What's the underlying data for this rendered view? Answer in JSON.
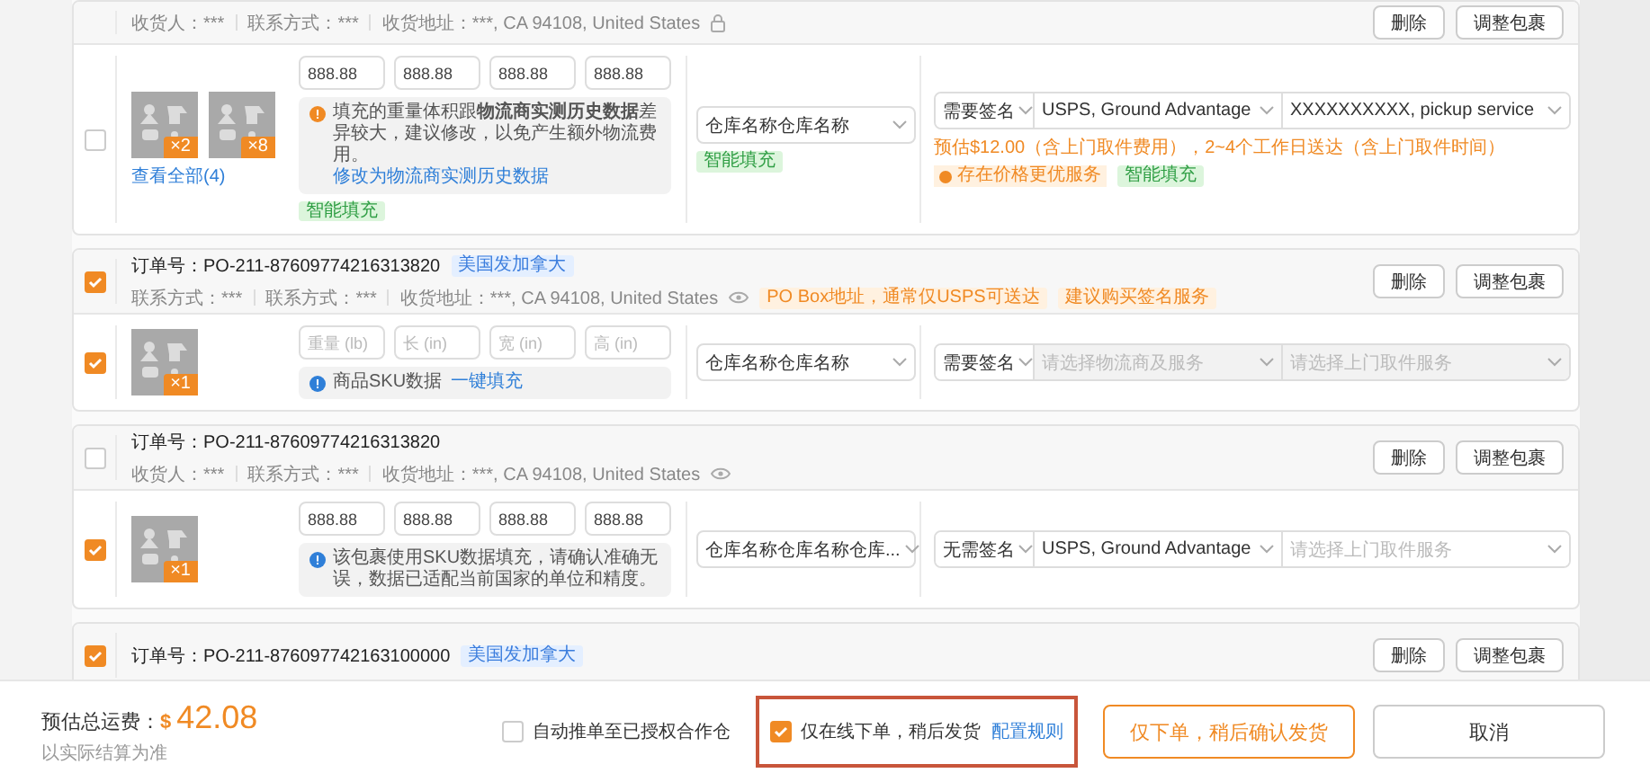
{
  "orders": [
    {
      "partial": true,
      "contacts": [
        "收货人：***",
        "联系方式：***",
        "收货地址：***, CA 94108, United States"
      ],
      "address_icon": {
        "kind": "lock"
      },
      "buttons": [
        "删除",
        "调整包裹"
      ],
      "packages": [
        {
          "checked": false,
          "items": [
            {
              "qty": "×2"
            },
            {
              "qty": "×8"
            }
          ],
          "view_all": "查看全部(4)",
          "dims": [
            {
              "value": "888.88"
            },
            {
              "value": "888.88"
            },
            {
              "value": "888.88"
            },
            {
              "value": "888.88"
            }
          ],
          "notice": {
            "kind": "warning",
            "text": "填充的重量体积跟**物流商实测历史数据**差异较大，建议修改，以免产生额外物流费用。",
            "link": "修改为物流商实测历史数据"
          },
          "dims_tag": "智能填充",
          "warehouse": "仓库名称仓库名称",
          "warehouse_tag": "智能填充",
          "sign": "需要签名",
          "carrier": {
            "value": "USPS, Ground Advantage",
            "disabled": false
          },
          "pickup": {
            "value": "XXXXXXXXXX, pickup service",
            "disabled": false
          },
          "estimate": "预估$12.00（含上门取件费用），2~4个工作日送达（含上门取件时间）",
          "hint": "存在价格更优服务",
          "ship_tag": "智能填充"
        }
      ]
    },
    {
      "checked": true,
      "order_no": "订单号：PO-211-87609774216313820",
      "tag": "美国发加拿大",
      "contacts": [
        "联系方式：***",
        "联系方式：***",
        "收货地址：***, CA 94108, United States"
      ],
      "address_icon": {
        "kind": "eye"
      },
      "warnings": [
        "PO Box地址，通常仅USPS可送达",
        "建议购买签名服务"
      ],
      "buttons": [
        "删除",
        "调整包裹"
      ],
      "packages": [
        {
          "checked": true,
          "items": [
            {
              "qty": "×1"
            }
          ],
          "dims": [
            {
              "placeholder": "重量 (lb)"
            },
            {
              "placeholder": "长 (in)"
            },
            {
              "placeholder": "宽 (in)"
            },
            {
              "placeholder": "高 (in)"
            }
          ],
          "notice": {
            "kind": "info",
            "text": "商品SKU数据",
            "link": "一键填充"
          },
          "warehouse": "仓库名称仓库名称",
          "sign": "需要签名",
          "carrier": {
            "placeholder": "请选择物流商及服务",
            "disabled": true
          },
          "pickup": {
            "placeholder": "请选择上门取件服务",
            "disabled": true
          }
        }
      ]
    },
    {
      "checked": false,
      "order_no": "订单号：PO-211-87609774216313820",
      "contacts": [
        "收货人：***",
        "联系方式：***",
        "收货地址：***, CA 94108, United States"
      ],
      "address_icon": {
        "kind": "eye"
      },
      "buttons": [
        "删除",
        "调整包裹"
      ],
      "packages": [
        {
          "checked": true,
          "items": [
            {
              "qty": "×1"
            }
          ],
          "dims": [
            {
              "value": "888.88"
            },
            {
              "value": "888.88"
            },
            {
              "value": "888.88"
            },
            {
              "value": "888.88"
            }
          ],
          "notice": {
            "kind": "info",
            "text": "该包裹使用SKU数据填充，请确认准确无误，数据已适配当前国家的单位和精度。"
          },
          "warehouse": "仓库名称仓库名称仓库...",
          "sign": "无需签名",
          "carrier": {
            "value": "USPS, Ground Advantage",
            "disabled": false
          },
          "pickup": {
            "placeholder": "请选择上门取件服务",
            "disabled": false
          }
        }
      ]
    },
    {
      "checked": true,
      "order_no": "订单号：PO-211-876097742163100000",
      "tag": "美国发加拿大",
      "buttons": [
        "删除",
        "调整包裹"
      ]
    }
  ],
  "footer": {
    "total_label": "预估总运费：",
    "currency": "$",
    "total": "42.08",
    "note": "以实际结算为准",
    "auto_push": {
      "label": "自动推单至已授权合作仓",
      "checked": false
    },
    "order_only": {
      "label": "仅在线下单，稍后发货",
      "checked": true,
      "link": "配置规则",
      "highlighted": true
    },
    "buttons": [
      {
        "label": "仅下单，稍后确认发货",
        "kind": "secondary"
      },
      {
        "label": "取消",
        "kind": "default"
      }
    ]
  }
}
